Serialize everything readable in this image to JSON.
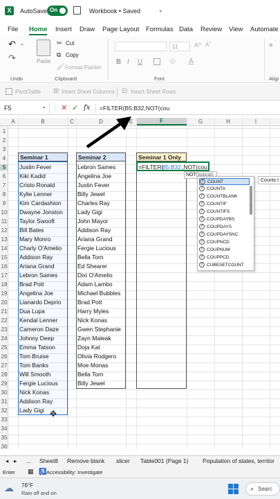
{
  "titlebar": {
    "autosave_label": "AutoSave",
    "autosave_state": "On",
    "workbook": "Workbook • Saved"
  },
  "tabs": [
    "File",
    "Home",
    "Insert",
    "Draw",
    "Page Layout",
    "Formulas",
    "Data",
    "Review",
    "View",
    "Automate"
  ],
  "active_tab": "Home",
  "ribbon": {
    "undo_group": "Undo",
    "paste": "Paste",
    "cut": "Cut",
    "copy": "Copy",
    "format_painter": "Format Painter",
    "clipboard": "Clipboard",
    "font_group": "Font",
    "font_size": "11",
    "bold": "B",
    "italic": "I",
    "underline": "U",
    "align_group": "Aligi"
  },
  "subribbon": {
    "pivot": "PivotTable",
    "insert_cols": "Insert Sheet Columns",
    "insert_rows": "Insert Sheet Rows"
  },
  "formula_bar": {
    "name_box": "F5",
    "fx": "fx",
    "formula": "=FILTER(B5:B32,NOT(cou"
  },
  "columns": [
    "A",
    "B",
    "C",
    "D",
    "E",
    "F",
    "G",
    "H",
    "I"
  ],
  "rows": [
    "1",
    "2",
    "3",
    "4",
    "5",
    "6",
    "7",
    "8",
    "9",
    "10",
    "11",
    "12",
    "13",
    "14",
    "15",
    "16",
    "17",
    "18",
    "19",
    "20",
    "21",
    "22",
    "23",
    "24",
    "25",
    "26",
    "27",
    "28",
    "29",
    "30",
    "31",
    "32",
    "33",
    "34",
    "35",
    "36"
  ],
  "seminar1": {
    "header": "Seminar 1",
    "names": [
      "Justin Fever",
      "Kiki Kadid",
      "Cristo Ronald",
      "Kylie Lenner",
      "Kim Cardashion",
      "Dwayne Jonston",
      "Taylor Swooft",
      "Bill Bates",
      "Mary Monro",
      "Charly O'Amelio",
      "Addison Ray",
      "Ariana Grand",
      "Lebron Sames",
      "Brad Pott",
      "Angelina Joe",
      "Lianardo Deprio",
      "Dua Lupa",
      "Kendal Lenner",
      "Cameron Daze",
      "Johnny Deep",
      "Emma Tatson",
      "Tom Bruise",
      "Tom Banks",
      "Will Smooth",
      "Fergie Lucious",
      "Nick Konas",
      "Addison Ray",
      "Lady Gigi"
    ]
  },
  "seminar2": {
    "header": "Seminar 2",
    "names": [
      "Lebron Sames",
      "Angelina Joe",
      "Justin Fever",
      "Billy Jewel",
      "Charles Ray",
      "Lady Gigi",
      "John Mayor",
      "Addison Ray",
      "Ariana Grand",
      "Fergie Lucious",
      "Bella Torn",
      "Ed Shearer",
      "Dixi O'Amelio",
      "Adam Lambo",
      "Michael Bubbles",
      "Brad Pott",
      "Harry Myles",
      "Nick Konas",
      "Gwen Stephanie",
      "Zayn Maleak",
      "Doja Kat",
      "Olivia Rodgero",
      "Moe Monas",
      "Bella Torn",
      "Billy Jewel"
    ]
  },
  "seminar1_only": {
    "header": "Seminar 1 Only"
  },
  "cell_edit": {
    "text_prefix": "=FILTER(",
    "range": "B5:B32",
    "text_suffix": ",NOT(cou"
  },
  "tooltip": {
    "fn": "NOT",
    "arg": "(logical)"
  },
  "autocomplete": [
    "COUNT",
    "COUNTA",
    "COUNTBLANK",
    "COUNTIF",
    "COUNTIFS",
    "COUPDAYBS",
    "COUPDAYS",
    "COUPDAYSNC",
    "COUPNCD",
    "COUPNUM",
    "COUPPCD",
    "CUBESETCOUNT"
  ],
  "side_tip": "Counts t",
  "sheet_tabs": [
    "...",
    "Sheet8",
    "Remove blank",
    "slicer",
    "Table001 (Page 1)",
    "Population of states, territor"
  ],
  "status": {
    "mode": "Enter",
    "accessibility": "Accessibility: Investigate"
  },
  "weather": {
    "temp": "76°F",
    "desc": "Rain off and on"
  },
  "taskbar_search": "Searc",
  "colors": {
    "excel_green": "#107c41",
    "accent_blue": "#1f6fd1",
    "header_fill": "#dbe7f6",
    "s1only_fill": "#fff2cc"
  }
}
